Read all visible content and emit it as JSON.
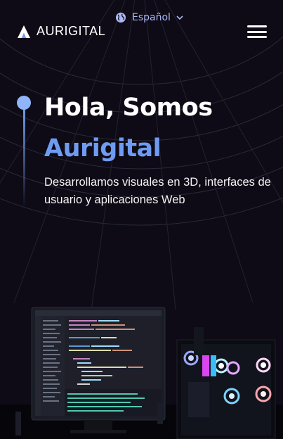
{
  "header": {
    "brand": "AURIGITAL",
    "language": "Español",
    "icons": {
      "logo": "triangle-logo-icon",
      "language": "globe-icon",
      "language_caret": "chevron-down-icon",
      "menu": "hamburger-menu-icon"
    }
  },
  "hero": {
    "title_line1": "Hola, Somos",
    "title_line2": "Aurigital",
    "subtitle": "Desarrollamos visuales en 3D, interfaces de usuario y aplicaciones Web"
  },
  "colors": {
    "background": "#0e0b16",
    "accent": "#6f9cf2",
    "language_text": "#aab8f5"
  }
}
